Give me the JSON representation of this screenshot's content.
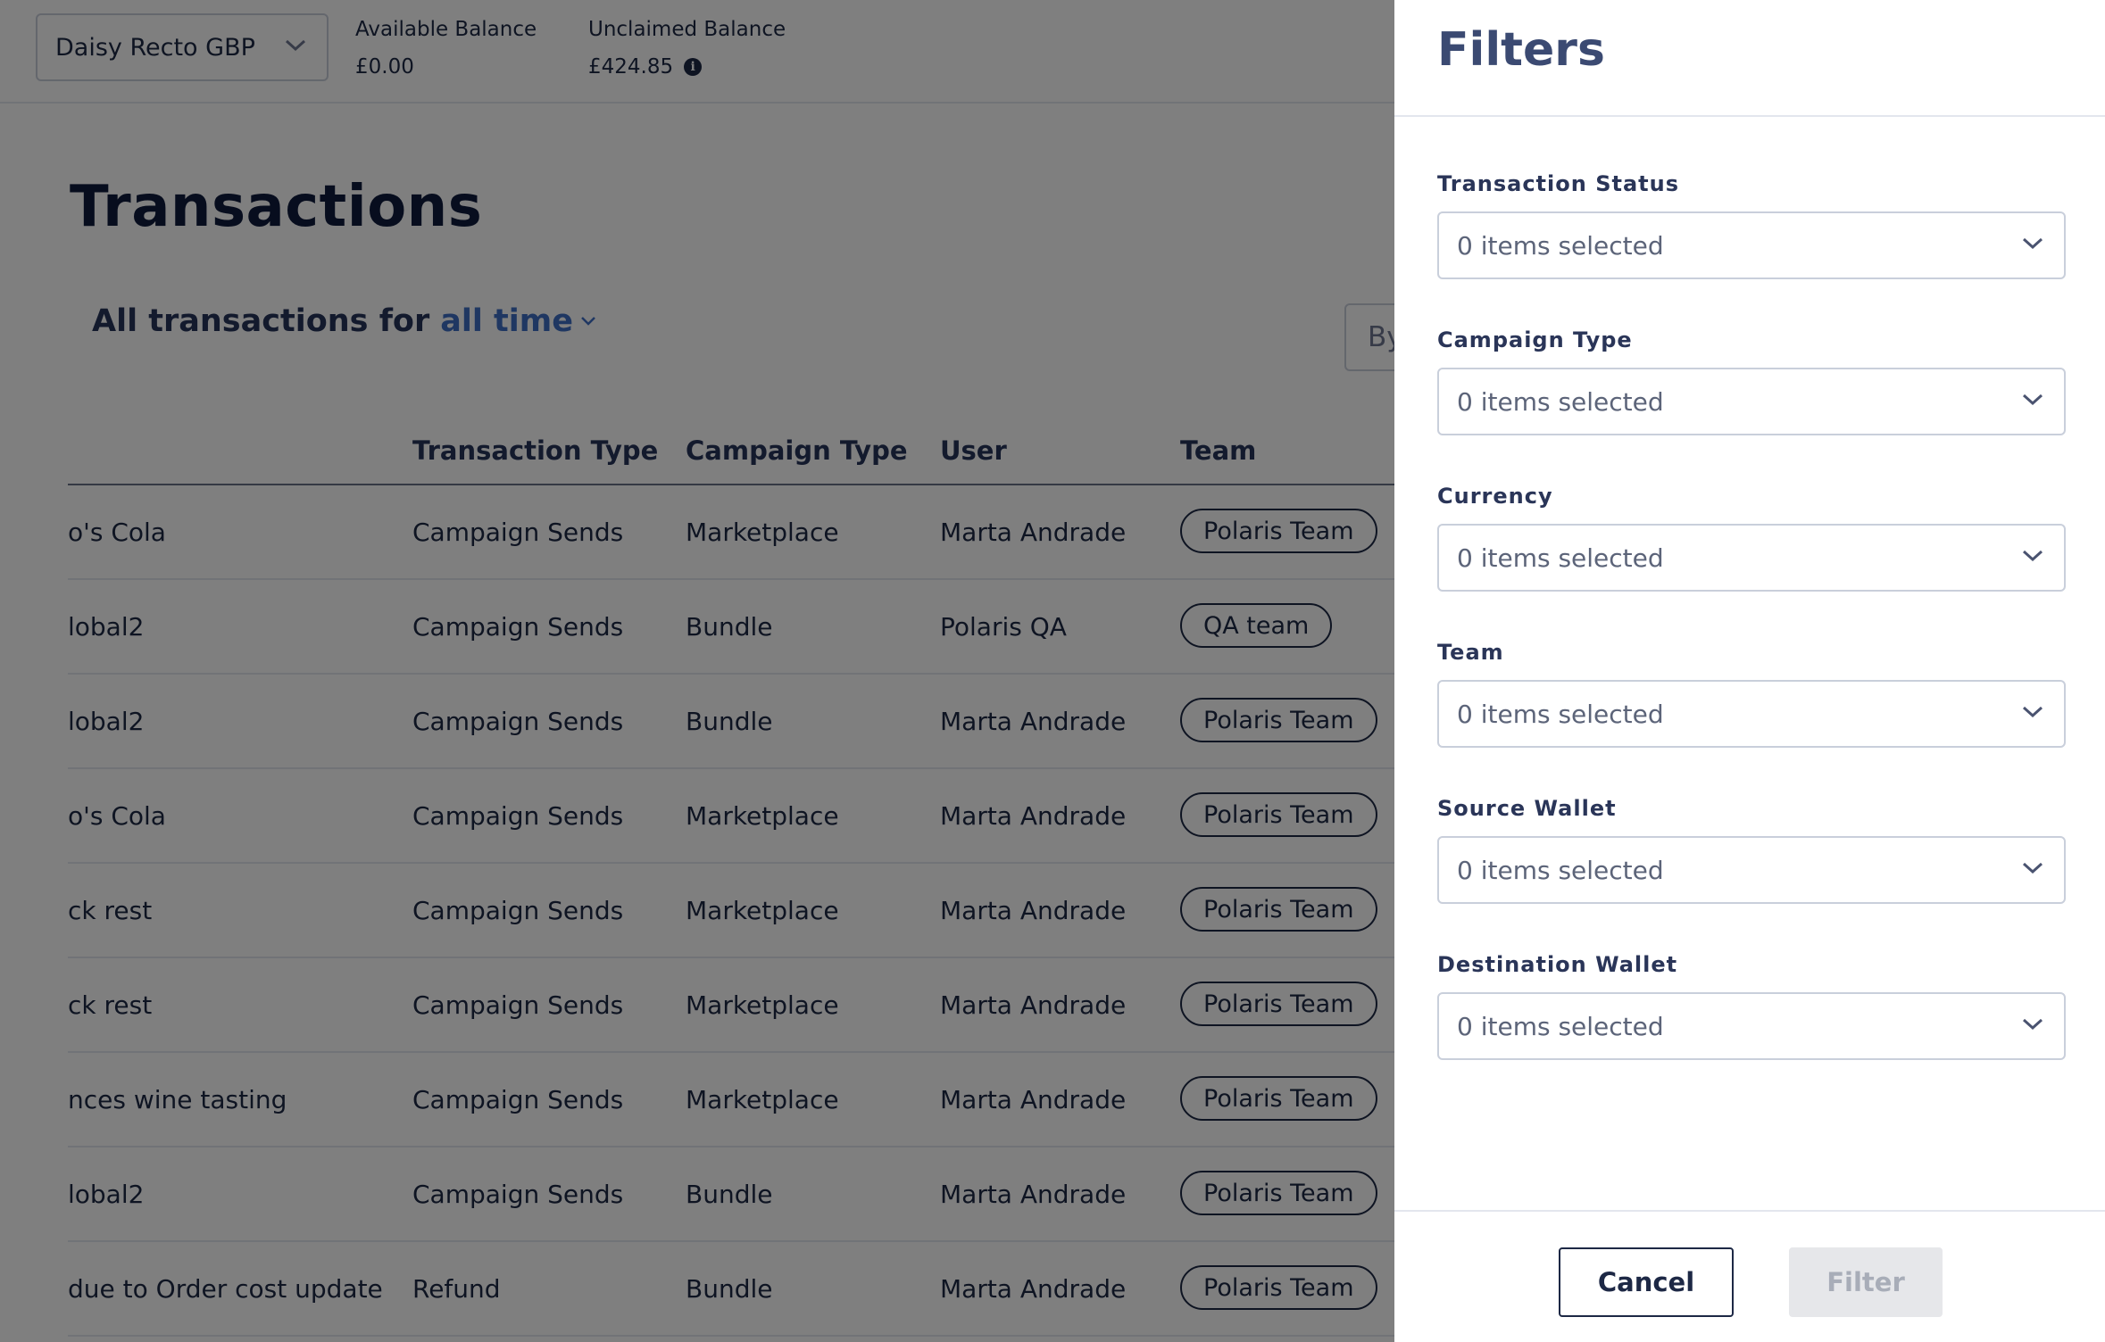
{
  "topbar": {
    "wallet_selector": {
      "value": "Daisy Recto GBP",
      "icon": "chevron-down-icon"
    },
    "available_balance": {
      "label": "Available Balance",
      "value": "£0.00"
    },
    "unclaimed_balance": {
      "label": "Unclaimed Balance",
      "value": "£424.85",
      "icon": "info-icon"
    }
  },
  "main": {
    "title": "Transactions",
    "period_prefix": "All transactions for",
    "period_value": "all time",
    "search_placeholder_visible": "By"
  },
  "table": {
    "columns": [
      "Transaction Type",
      "Campaign Type",
      "User",
      "Team"
    ],
    "rows": [
      {
        "name": "o's Cola",
        "transaction_type": "Campaign Sends",
        "campaign_type": "Marketplace",
        "user": "Marta Andrade",
        "team": "Polaris Team"
      },
      {
        "name": "lobal2",
        "transaction_type": "Campaign Sends",
        "campaign_type": "Bundle",
        "user": "Polaris QA",
        "team": "QA team"
      },
      {
        "name": "lobal2",
        "transaction_type": "Campaign Sends",
        "campaign_type": "Bundle",
        "user": "Marta Andrade",
        "team": "Polaris Team"
      },
      {
        "name": "o's Cola",
        "transaction_type": "Campaign Sends",
        "campaign_type": "Marketplace",
        "user": "Marta Andrade",
        "team": "Polaris Team"
      },
      {
        "name": "ck rest",
        "transaction_type": "Campaign Sends",
        "campaign_type": "Marketplace",
        "user": "Marta Andrade",
        "team": "Polaris Team"
      },
      {
        "name": "ck rest",
        "transaction_type": "Campaign Sends",
        "campaign_type": "Marketplace",
        "user": "Marta Andrade",
        "team": "Polaris Team"
      },
      {
        "name": "nces wine tasting",
        "transaction_type": "Campaign Sends",
        "campaign_type": "Marketplace",
        "user": "Marta Andrade",
        "team": "Polaris Team"
      },
      {
        "name": "lobal2",
        "transaction_type": "Campaign Sends",
        "campaign_type": "Bundle",
        "user": "Marta Andrade",
        "team": "Polaris Team"
      },
      {
        "name": "due to Order cost update",
        "transaction_type": "Refund",
        "campaign_type": "Bundle",
        "user": "Marta Andrade",
        "team": "Polaris Team"
      }
    ]
  },
  "filters_panel": {
    "title": "Filters",
    "groups": [
      {
        "label": "Transaction Status",
        "value": "0 items selected"
      },
      {
        "label": "Campaign Type",
        "value": "0 items selected"
      },
      {
        "label": "Currency",
        "value": "0 items selected"
      },
      {
        "label": "Team",
        "value": "0 items selected"
      },
      {
        "label": "Source Wallet",
        "value": "0 items selected"
      },
      {
        "label": "Destination Wallet",
        "value": "0 items selected"
      }
    ],
    "cancel_label": "Cancel",
    "filter_label": "Filter",
    "filter_enabled": false
  },
  "colors": {
    "overlay": "#000000",
    "text_primary": "#1d2845",
    "link": "#3f6fc4",
    "disabled_button_bg": "#e6e7ea"
  }
}
